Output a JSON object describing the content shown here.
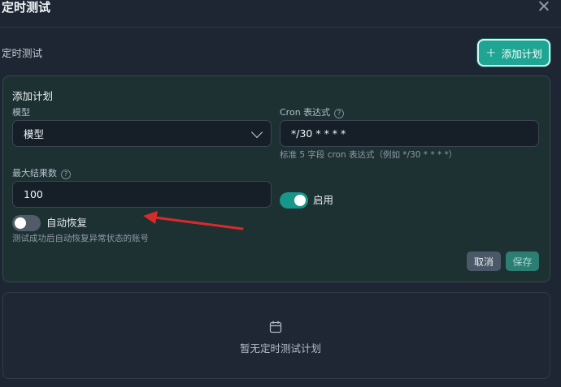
{
  "header": {
    "title": "定时测试",
    "close_icon": "close-icon"
  },
  "toolbar": {
    "section_label": "定时测试",
    "add_plan_label": "添加计划",
    "add_plan_icon": "plus-icon"
  },
  "form": {
    "title": "添加计划",
    "model": {
      "label": "模型",
      "value": "模型"
    },
    "cron": {
      "label": "Cron 表达式",
      "value": "*/30 * * * *",
      "hint": "标准 5 字段 cron 表达式（例如 */30 * * * *）"
    },
    "max_results": {
      "label": "最大结果数",
      "value": "100"
    },
    "enabled": {
      "label": "启用",
      "on": true
    },
    "auto_recover": {
      "label": "自动恢复",
      "on": false,
      "hint": "测试成功后自动恢复异常状态的账号"
    },
    "cancel_label": "取消",
    "save_label": "保存"
  },
  "empty_state": {
    "icon": "calendar-icon",
    "text": "暂无定时测试计划"
  },
  "colors": {
    "accent": "#1fa594",
    "annotation_arrow": "#d92a2a"
  }
}
